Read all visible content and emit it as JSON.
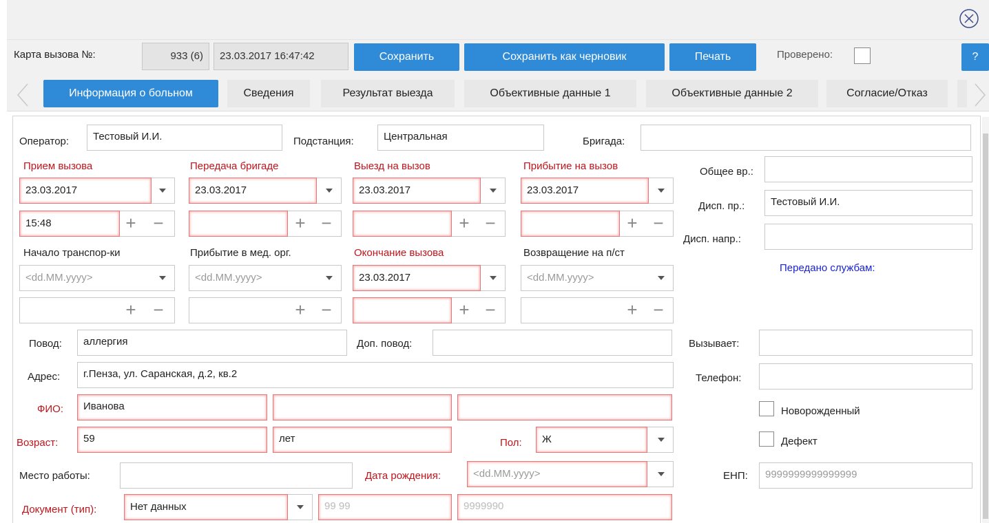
{
  "header": {
    "card_label": "Карта вызова №:",
    "card_number": "933 (6)",
    "card_datetime": "23.03.2017 16:47:42",
    "save_label": "Сохранить",
    "save_draft_label": "Сохранить как черновик",
    "print_label": "Печать",
    "checked_label": "Проверено:",
    "help_label": "?"
  },
  "tabs": [
    {
      "label": "Информация о больном",
      "active": true
    },
    {
      "label": "Сведения"
    },
    {
      "label": "Результат выезда"
    },
    {
      "label": "Объективные данные 1"
    },
    {
      "label": "Объективные данные 2"
    },
    {
      "label": "Согласие/Отказ"
    }
  ],
  "form": {
    "operator_label": "Оператор:",
    "operator_value": "Тестовый И.И.",
    "substation_label": "Подстанция:",
    "substation_value": "Центральная",
    "brigade_label": "Бригада:",
    "brigade_value": "",
    "times": [
      {
        "label": "Прием вызова",
        "date": "23.03.2017",
        "time": "15:48",
        "required": true
      },
      {
        "label": "Передача бригаде",
        "date": "23.03.2017",
        "time": "",
        "required": true
      },
      {
        "label": "Выезд на вызов",
        "date": "23.03.2017",
        "time": "",
        "required": true
      },
      {
        "label": "Прибытие на вызов",
        "date": "23.03.2017",
        "time": "",
        "required": true
      },
      {
        "label": "Начало транспор-ки",
        "date": "<dd.MM.yyyy>",
        "time": "",
        "required": false
      },
      {
        "label": "Прибытие в мед. орг.",
        "date": "<dd.MM.yyyy>",
        "time": "",
        "required": false
      },
      {
        "label": "Окончание вызова",
        "date": "23.03.2017",
        "time": "",
        "required": true
      },
      {
        "label": "Возвращение на п/ст",
        "date": "<dd.MM.yyyy>",
        "time": "",
        "required": false
      }
    ],
    "total_time_label": "Общее вр.:",
    "total_time_value": "",
    "disp_pr_label": "Дисп. пр.:",
    "disp_pr_value": "Тестовый И.И.",
    "disp_napr_label": "Дисп. напр.:",
    "disp_napr_value": "",
    "transferred_label": "Передано службам:",
    "reason_label": "Повод:",
    "reason_value": "аллергия",
    "add_reason_label": "Доп. повод:",
    "add_reason_value": "",
    "caller_label": "Вызывает:",
    "caller_value": "",
    "address_label": "Адрес:",
    "address_value": "г.Пенза, ул. Саранская, д.2, кв.2",
    "phone_label": "Телефон:",
    "phone_value": "",
    "fio_label": "ФИО:",
    "fio_last": "Иванова",
    "fio_first": "",
    "fio_middle": "",
    "newborn_label": "Новорожденный",
    "age_label": "Возраст:",
    "age_value": "59",
    "age_unit": "лет",
    "sex_label": "Пол:",
    "sex_value": "Ж",
    "defect_label": "Дефект",
    "workplace_label": "Место работы:",
    "workplace_value": "",
    "birth_label": "Дата рождения:",
    "birth_placeholder": "<dd.MM.yyyy>",
    "enp_label": "ЕНП:",
    "enp_placeholder": "9999999999999999",
    "doc_label": "Документ (тип):",
    "doc_value": "Нет данных",
    "doc_series_placeholder": "99 99",
    "doc_number_placeholder": "9999990"
  },
  "colors": {
    "accent": "#2f8bd8",
    "required": "#c0141b",
    "link": "#1a23d6"
  }
}
